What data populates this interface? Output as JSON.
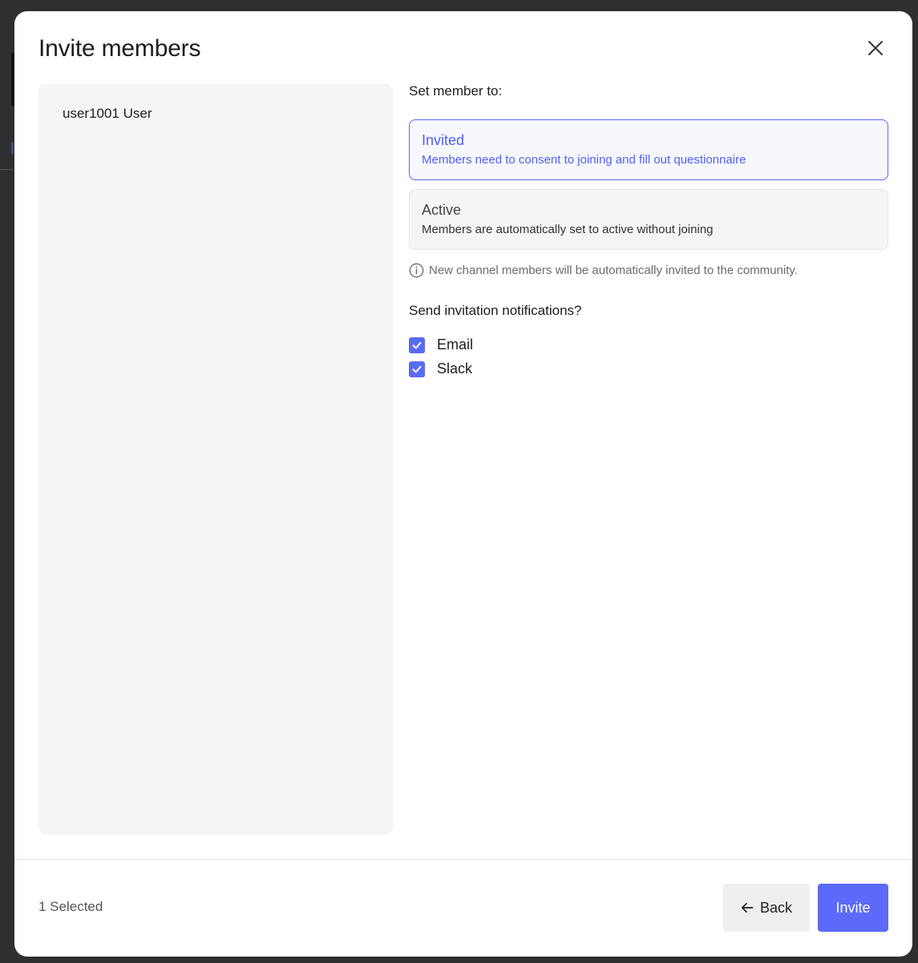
{
  "modal": {
    "title": "Invite members",
    "close_icon": "close-icon"
  },
  "members": {
    "items": [
      {
        "name": "user1001 User"
      }
    ]
  },
  "settings": {
    "set_member_label": "Set member to:",
    "options": [
      {
        "title": "Invited",
        "description": "Members need to consent to joining and fill out questionnaire",
        "selected": true
      },
      {
        "title": "Active",
        "description": "Members are automatically set to active without joining",
        "selected": false
      }
    ],
    "info_icon": "info-icon",
    "info_note": "New channel members will be automatically invited to the community.",
    "notifications_label": "Send invitation notifications?",
    "notifications": [
      {
        "label": "Email",
        "checked": true
      },
      {
        "label": "Slack",
        "checked": true
      }
    ]
  },
  "footer": {
    "selected_count": "1 Selected",
    "back_label": "Back",
    "back_icon": "arrow-left-icon",
    "invite_label": "Invite"
  },
  "colors": {
    "accent": "#5b6af8",
    "selected_bg": "#f6f8fe",
    "panel_bg": "#f5f5f5",
    "backdrop": "#2e2f31"
  }
}
